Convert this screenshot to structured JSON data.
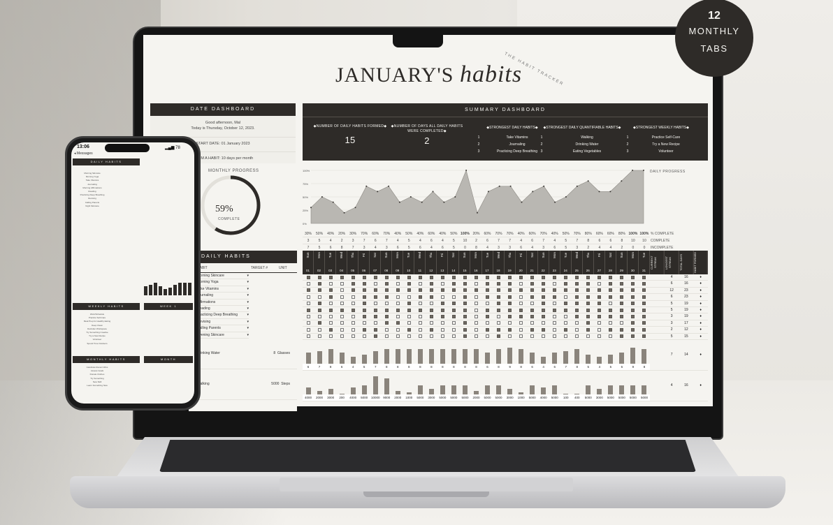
{
  "badge": {
    "number": "12",
    "line1": "MONTHLY",
    "line2": "TABS"
  },
  "title": {
    "main": "JANUARY'S",
    "script": "habits",
    "brand": "THE HABIT TRACKER"
  },
  "date_dashboard": {
    "header": "DATE DASHBOARD",
    "greeting": "Good afternoon, Mal",
    "today": "Today is Thursday, October 12, 2023.",
    "start_date": "START DATE:  01 January 2023",
    "form_habit": "FORM A HABIT:  10  days per month"
  },
  "summary": {
    "header": "SUMMARY DASHBOARD",
    "metric1_label": "◆NUMBER OF DAILY HABITS FORMED◆",
    "metric1_value": "15",
    "metric2_label": "◆NUMBER OF DAYS ALL DAILY HABITS WERE COMPLETED◆",
    "metric2_value": "2",
    "strongest_daily_title": "◆STRONGEST DAILY HABITS◆",
    "strongest_daily": [
      "Take Vitamins",
      "Journaling",
      "Practicing Deep Breathing"
    ],
    "strongest_quant_title": "◆STRONGEST DAILY QUANTIFIABLE HABITS◆",
    "strongest_quant": [
      "Walking",
      "Drinking Water",
      "Eating Vegetables"
    ],
    "strongest_weekly_title": "◆STRONGEST WEEKLY HABITS◆",
    "strongest_weekly": [
      "Practice Self-Care",
      "Try a New Recipe",
      "Volunteer"
    ]
  },
  "monthly_progress": {
    "label": "MONTHLY PROGRESS",
    "value": "59%",
    "fraction": 0.59,
    "sub": "COMPLETE"
  },
  "chart_data": {
    "type": "area",
    "title": "",
    "ylabel_right": "DAILY PROGRESS",
    "y_ticks": [
      "100%",
      "75%",
      "50%",
      "25%",
      "0%"
    ],
    "ylim": [
      0,
      100
    ],
    "x": [
      1,
      2,
      3,
      4,
      5,
      6,
      7,
      8,
      9,
      10,
      11,
      12,
      13,
      14,
      15,
      16,
      17,
      18,
      19,
      20,
      21,
      22,
      23,
      24,
      25,
      26,
      27,
      28,
      29,
      30,
      31
    ],
    "values": [
      30,
      50,
      40,
      20,
      30,
      70,
      60,
      70,
      40,
      50,
      40,
      60,
      40,
      50,
      100,
      20,
      60,
      70,
      70,
      40,
      60,
      70,
      40,
      50,
      70,
      80,
      60,
      60,
      80,
      100,
      100
    ],
    "color": "#b9b7b2"
  },
  "pct_row": [
    "30%",
    "50%",
    "40%",
    "20%",
    "30%",
    "70%",
    "60%",
    "70%",
    "40%",
    "50%",
    "40%",
    "60%",
    "40%",
    "50%",
    "100%",
    "20%",
    "60%",
    "70%",
    "70%",
    "40%",
    "60%",
    "70%",
    "40%",
    "50%",
    "70%",
    "80%",
    "60%",
    "60%",
    "80%",
    "100%",
    "100%"
  ],
  "complete_row": [
    "3",
    "5",
    "4",
    "2",
    "3",
    "7",
    "6",
    "7",
    "4",
    "5",
    "4",
    "6",
    "4",
    "5",
    "10",
    "2",
    "6",
    "7",
    "7",
    "4",
    "6",
    "7",
    "4",
    "5",
    "7",
    "8",
    "6",
    "6",
    "8",
    "10",
    "10"
  ],
  "incomplete_row": [
    "7",
    "5",
    "6",
    "8",
    "7",
    "3",
    "4",
    "3",
    "6",
    "5",
    "6",
    "4",
    "6",
    "5",
    "0",
    "8",
    "4",
    "3",
    "3",
    "6",
    "4",
    "3",
    "6",
    "5",
    "3",
    "2",
    "4",
    "4",
    "2",
    "0",
    "0"
  ],
  "row_labels": [
    "% COMPLETE",
    "COMPLETE",
    "INCOMPLETE"
  ],
  "weekdays": [
    "Sun",
    "Mon",
    "Tue",
    "Wed",
    "Thu",
    "Fri",
    "Sat",
    "Sun",
    "Mon",
    "Tue",
    "Wed",
    "Thu",
    "Fri",
    "Sat",
    "Sun",
    "Mon",
    "Tue",
    "Wed",
    "Thu",
    "Fri",
    "Sat",
    "Sun",
    "Mon",
    "Tue",
    "Wed",
    "Thu",
    "Fri",
    "Sat",
    "Sun",
    "Mon",
    "Tue"
  ],
  "dates": [
    "01",
    "02",
    "03",
    "04",
    "05",
    "06",
    "07",
    "08",
    "09",
    "10",
    "11",
    "12",
    "13",
    "14",
    "15",
    "16",
    "17",
    "18",
    "19",
    "20",
    "21",
    "22",
    "23",
    "24",
    "25",
    "26",
    "27",
    "28",
    "29",
    "30",
    "31"
  ],
  "daily_habits": {
    "header": "DAILY HABITS",
    "col_habit": "HABIT",
    "col_target": "TARGET #",
    "col_unit": "UNIT",
    "habits": [
      "Morning Skincare",
      "Morning Yoga",
      "Take Vitamins",
      "Journaling",
      "Affirmations",
      "Reading",
      "Practicing Deep Breathing",
      "Revising",
      "Calling Parents",
      "Evening Skincare"
    ],
    "quant": [
      {
        "name": "Drinking Water",
        "target": "8",
        "unit": "Glasses"
      },
      {
        "name": "Walking",
        "target": "5000",
        "unit": "Steps"
      }
    ]
  },
  "checks": [
    [
      1,
      1,
      1,
      1,
      1,
      1,
      1,
      1,
      1,
      1,
      1,
      1,
      1,
      1,
      1,
      1,
      1,
      1,
      1,
      1,
      1,
      1,
      1,
      1,
      1,
      1,
      1,
      1,
      1,
      1,
      1
    ],
    [
      0,
      1,
      0,
      0,
      1,
      1,
      0,
      1,
      0,
      1,
      0,
      1,
      0,
      1,
      1,
      0,
      1,
      1,
      1,
      0,
      1,
      1,
      0,
      1,
      1,
      1,
      0,
      1,
      1,
      1,
      1
    ],
    [
      1,
      1,
      1,
      0,
      1,
      1,
      1,
      1,
      1,
      1,
      1,
      1,
      1,
      1,
      1,
      1,
      1,
      1,
      1,
      1,
      1,
      1,
      1,
      1,
      1,
      1,
      1,
      1,
      1,
      1,
      1
    ],
    [
      0,
      0,
      1,
      0,
      0,
      1,
      1,
      1,
      0,
      0,
      1,
      1,
      0,
      0,
      1,
      0,
      1,
      1,
      1,
      0,
      1,
      1,
      1,
      0,
      1,
      1,
      1,
      1,
      1,
      1,
      1
    ],
    [
      0,
      1,
      0,
      0,
      0,
      1,
      0,
      0,
      0,
      1,
      0,
      0,
      1,
      1,
      1,
      0,
      0,
      1,
      1,
      0,
      0,
      1,
      0,
      1,
      1,
      1,
      1,
      0,
      1,
      1,
      1
    ],
    [
      1,
      1,
      1,
      1,
      1,
      1,
      1,
      1,
      1,
      1,
      1,
      1,
      1,
      1,
      1,
      0,
      1,
      1,
      1,
      1,
      1,
      1,
      1,
      1,
      1,
      1,
      1,
      1,
      1,
      1,
      1
    ],
    [
      0,
      0,
      0,
      0,
      0,
      1,
      1,
      1,
      0,
      0,
      0,
      1,
      1,
      1,
      1,
      0,
      1,
      0,
      1,
      1,
      1,
      1,
      0,
      0,
      1,
      1,
      1,
      1,
      1,
      1,
      1
    ],
    [
      0,
      1,
      0,
      0,
      0,
      0,
      0,
      1,
      1,
      0,
      0,
      0,
      0,
      0,
      1,
      0,
      0,
      0,
      0,
      0,
      0,
      0,
      0,
      0,
      0,
      1,
      0,
      0,
      0,
      1,
      1
    ],
    [
      0,
      0,
      1,
      0,
      0,
      1,
      1,
      0,
      0,
      1,
      0,
      1,
      0,
      0,
      1,
      0,
      1,
      1,
      1,
      0,
      1,
      1,
      0,
      1,
      0,
      1,
      0,
      1,
      1,
      1,
      1
    ],
    [
      0,
      0,
      0,
      0,
      0,
      0,
      1,
      0,
      0,
      0,
      0,
      0,
      0,
      0,
      1,
      0,
      0,
      1,
      0,
      0,
      0,
      0,
      0,
      0,
      0,
      0,
      0,
      0,
      1,
      1,
      1
    ]
  ],
  "water_values": [
    6,
    7,
    8,
    6,
    4,
    5,
    7,
    8,
    8,
    8,
    8,
    8,
    8,
    8,
    8,
    8,
    6,
    8,
    9,
    8,
    6,
    4,
    6,
    7,
    8,
    5,
    4,
    5,
    6,
    9,
    8
  ],
  "walking_values": [
    4000,
    2000,
    3000,
    200,
    4000,
    5000,
    10000,
    9000,
    2000,
    1000,
    5000,
    3000,
    5000,
    5000,
    5000,
    2000,
    5000,
    5000,
    3000,
    1000,
    5000,
    4000,
    5000,
    100,
    400,
    5000,
    3000,
    5000,
    5000,
    5000,
    5000
  ],
  "stats": {
    "headers": [
      "CURRENT STREAK",
      "LONGEST STREAK",
      "TOTAL DAYS",
      "HABIT FORMED"
    ],
    "rows": [
      [
        "",
        "4",
        "16",
        "♦"
      ],
      [
        "",
        "6",
        "16",
        "♦"
      ],
      [
        "",
        "12",
        "23",
        "♦"
      ],
      [
        "",
        "6",
        "23",
        "♦"
      ],
      [
        "",
        "5",
        "19",
        "♦"
      ],
      [
        "",
        "5",
        "19",
        "♦"
      ],
      [
        "",
        "3",
        "19",
        "♦"
      ],
      [
        "",
        "3",
        "17",
        "♦"
      ],
      [
        "",
        "2",
        "12",
        "♦"
      ],
      [
        "",
        "5",
        "15",
        "♦"
      ]
    ],
    "quant_rows": [
      [
        "",
        "7",
        "14",
        "♦"
      ],
      [
        "",
        "4",
        "16",
        "♦"
      ]
    ]
  },
  "phone": {
    "time": "13:06",
    "back": "◂ Messages",
    "status_right": "▂▄▆ 78",
    "daily_header": "DAILY HABITS",
    "weekly_header": "WEEKLY HABITS",
    "monthly_header": "MONTHLY HABITS",
    "daily_list": [
      "Morning Skincare",
      "Morning Yoga",
      "Take Vitamins",
      "Journaling",
      "Morning Affirmations",
      "Reading",
      "Practicing Deep Breathing",
      "Revising",
      "Calling Parents",
      "Night Skincare"
    ],
    "weekly_list": [
      "Work/Schedule",
      "Practice Self-Care",
      "Meal Prep for Healthy Eating",
      "Deep Clean",
      "Declutter Workspace",
      "Try Something Creative",
      "Try a New Recipe",
      "Volunteer",
      "Spend Time Outdoors"
    ],
    "monthly_list": [
      "Celebrate Recent Wins",
      "Assess Goals",
      "Donate Clothes",
      "Try Something",
      "New Skill",
      "Learn Something New"
    ],
    "week_label": "WEEK 1",
    "month_label": "MONTH"
  }
}
